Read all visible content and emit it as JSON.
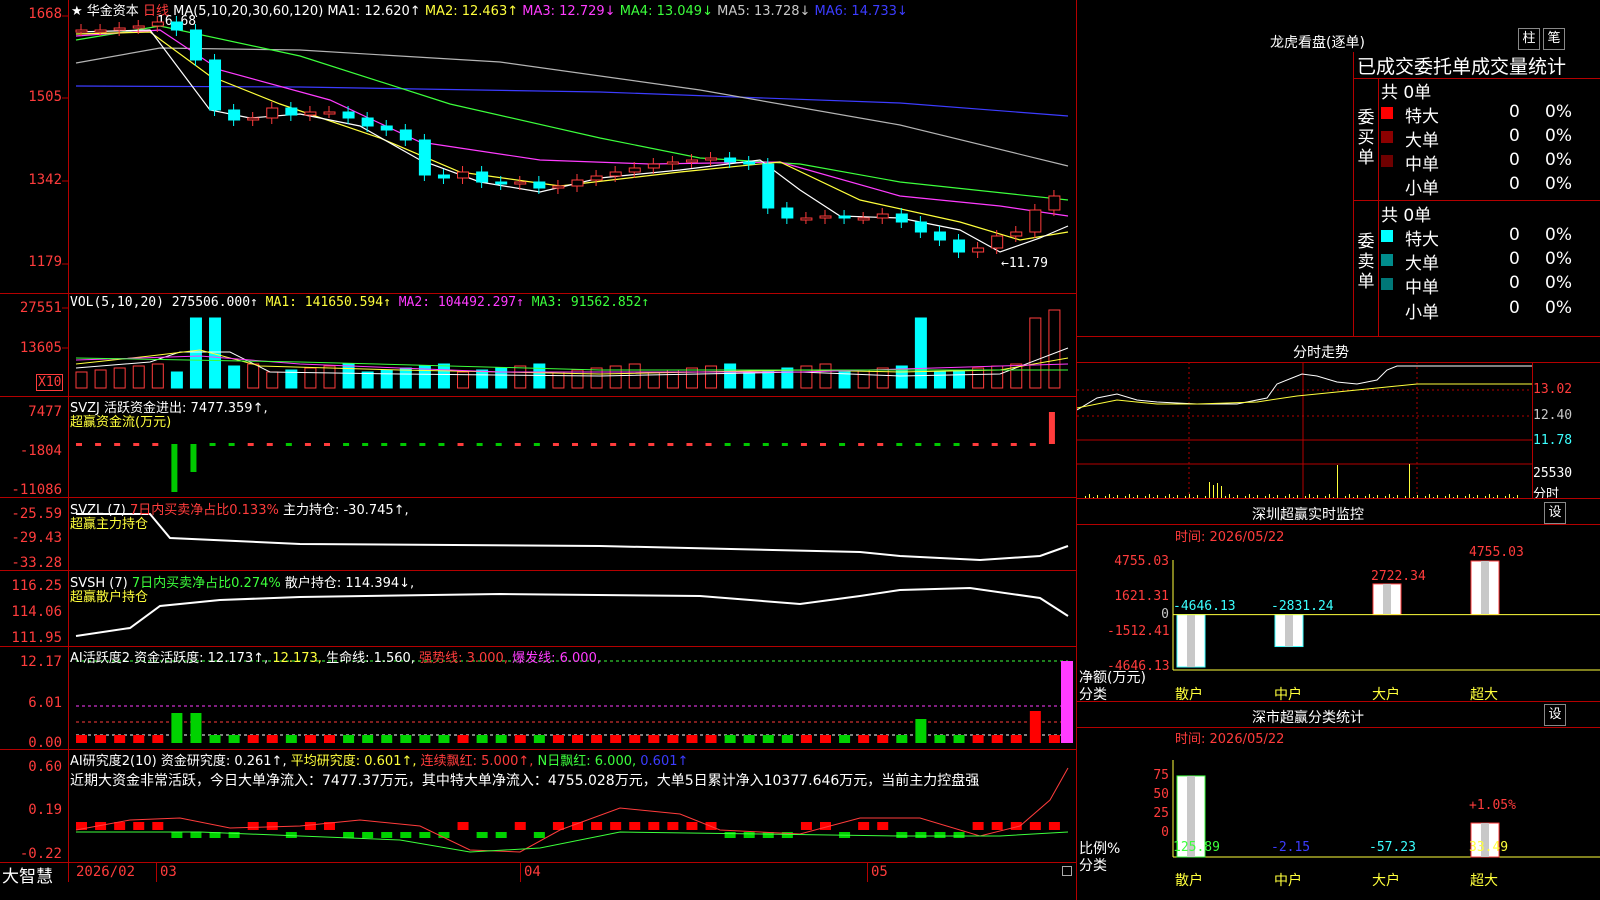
{
  "stock": {
    "star": "★",
    "name": "华金资本",
    "period": "日线"
  },
  "ma_header": {
    "label": "MA(5,10,20,30,60,120)",
    "ma1": "MA1: 12.620↑",
    "ma2": "MA2: 12.463↑",
    "ma3": "MA3: 12.729↓",
    "ma4": "MA4: 13.049↓",
    "ma5": "MA5: 13.728↓",
    "ma6": "MA6: 14.733↓"
  },
  "price_axis": [
    "1668",
    "1505",
    "1342",
    "1179"
  ],
  "price_marks": {
    "high": "16.68",
    "low": "←11.79"
  },
  "vol": {
    "header": "VOL(5,10,20)",
    "value": "275506.000↑",
    "ma1": "MA1: 141650.594↑",
    "ma2": "MA2: 104492.297↑",
    "ma3": "MA3: 91562.852↑",
    "axis": [
      "27551",
      "13605"
    ],
    "unit": "X10"
  },
  "svzj": {
    "header": "SVZJ",
    "desc": "活跃资金进出: 7477.359↑,",
    "sub": "超赢资金流(万元)",
    "axis": [
      "7477",
      "-1804",
      "-11086"
    ]
  },
  "svzl": {
    "header": "SVZL (7)",
    "desc1": "7日内买卖净占比0.133%",
    "desc2": "主力持仓: -30.745↑,",
    "sub": "超赢主力持仓",
    "axis": [
      "-25.59",
      "-29.43",
      "-33.28"
    ]
  },
  "svsh": {
    "header": "SVSH (7)",
    "desc1": "7日内买卖净占比0.274%",
    "desc2": "散户持仓: 114.394↓,",
    "sub": "超赢散户持仓",
    "axis": [
      "116.25",
      "114.06",
      "111.95"
    ]
  },
  "ai_active": {
    "header": "AI活跃度2",
    "d1": "资金活跃度: 12.173↑,",
    "d2": "12.173,",
    "d3": "生命线: 1.560,",
    "d4": "强势线: 3.000,",
    "d5": "爆发线: 6.000,",
    "axis": [
      "12.17",
      "6.01",
      "0.00"
    ]
  },
  "ai_research": {
    "header": "AI研究度2(10)",
    "d1": "资金研究度: 0.261↑,",
    "d2": "平均研究度: 0.601↑,",
    "d3": "连续飘红: 5.000↑,",
    "d4": "N日飘红: 6.000,",
    "d5": "0.601↑",
    "note": "近期大资金非常活跃，今日大单净流入：7477.37万元，其中特大单净流入：4755.028万元，大单5日累计净入10377.646万元，当前主力控盘强",
    "axis": [
      "0.60",
      "0.19",
      "-0.22"
    ]
  },
  "bottom_bar": {
    "brand": "大智慧",
    "date1": "2026/02",
    "m3": "03",
    "m4": "04",
    "m5": "05"
  },
  "dragon": {
    "title": "龙虎看盘(逐单)",
    "btn1": "柱",
    "btn2": "笔",
    "subtitle": "已成交委托单成交量统计",
    "buy_label": "委买单",
    "sell_label": "委卖单",
    "buy_total": "共 0单",
    "sell_total": "共 0单",
    "buy_rows": [
      {
        "name": "特大",
        "count": "0",
        "pct": "0%",
        "color": "#ff0000"
      },
      {
        "name": "大单",
        "count": "0",
        "pct": "0%",
        "color": "#8c0000"
      },
      {
        "name": "中单",
        "count": "0",
        "pct": "0%",
        "color": "#6e0000"
      },
      {
        "name": "小单",
        "count": "0",
        "pct": "0%",
        "color": "#000000"
      }
    ],
    "sell_rows": [
      {
        "name": "特大",
        "count": "0",
        "pct": "0%",
        "color": "#00ffff"
      },
      {
        "name": "大单",
        "count": "0",
        "pct": "0%",
        "color": "#008c8c"
      },
      {
        "name": "中单",
        "count": "0",
        "pct": "0%",
        "color": "#007878"
      },
      {
        "name": "小单",
        "count": "0",
        "pct": "0%",
        "color": "#000000"
      }
    ]
  },
  "intraday": {
    "title": "分时走势",
    "axis": [
      "13.02",
      "12.40",
      "11.78"
    ],
    "vol_axis": "25530",
    "vol_unit": "分时"
  },
  "sz_monitor": {
    "title": "深圳超赢实时监控",
    "btn": "设",
    "time": "时间: 2026/05/22",
    "axis": [
      "4755.03",
      "1621.31",
      "0",
      "-1512.41",
      "-4646.13"
    ],
    "ylabel": "净额(万元)",
    "xlabel": "分类",
    "bars": [
      {
        "cat": "散户",
        "value": -4646.13,
        "label": "-4646.13"
      },
      {
        "cat": "中户",
        "value": -2831.24,
        "label": "-2831.24"
      },
      {
        "cat": "大户",
        "value": 2722.34,
        "label": "2722.34"
      },
      {
        "cat": "超大",
        "value": 4755.03,
        "label": "4755.03"
      }
    ]
  },
  "sz_class": {
    "title": "深市超赢分类统计",
    "btn": "设",
    "time": "时间: 2026/05/22",
    "axis": [
      "75",
      "50",
      "25",
      "0"
    ],
    "ylabel": "比例%",
    "xlabel": "分类",
    "bars": [
      {
        "cat": "散户",
        "value": 125.89,
        "label": "125.89"
      },
      {
        "cat": "中户",
        "value": -2.15,
        "label": "-2.15"
      },
      {
        "cat": "大户",
        "value": -57.23,
        "label": "-57.23"
      },
      {
        "cat": "超大",
        "value": 33.49,
        "label": "33.49"
      }
    ],
    "extra_label": "+1.05%"
  },
  "chart_data": [
    {
      "type": "bar",
      "title": "深圳超赢实时监控",
      "categories": [
        "散户",
        "中户",
        "大户",
        "超大"
      ],
      "values": [
        -4646.13,
        -2831.24,
        2722.34,
        4755.03
      ],
      "ylabel": "净额(万元)",
      "xlabel": "分类",
      "ylim": [
        -4646.13,
        4755.03
      ]
    },
    {
      "type": "bar",
      "title": "深市超赢分类统计",
      "categories": [
        "散户",
        "中户",
        "大户",
        "超大"
      ],
      "values": [
        125.89,
        -2.15,
        -57.23,
        33.49
      ],
      "ylabel": "比例%",
      "xlabel": "分类",
      "ylim": [
        0,
        75
      ]
    }
  ],
  "colors": {
    "up": "#ff3c3c",
    "down": "#00ffff",
    "grid": "#b40000",
    "vol_green": "#00e000"
  }
}
